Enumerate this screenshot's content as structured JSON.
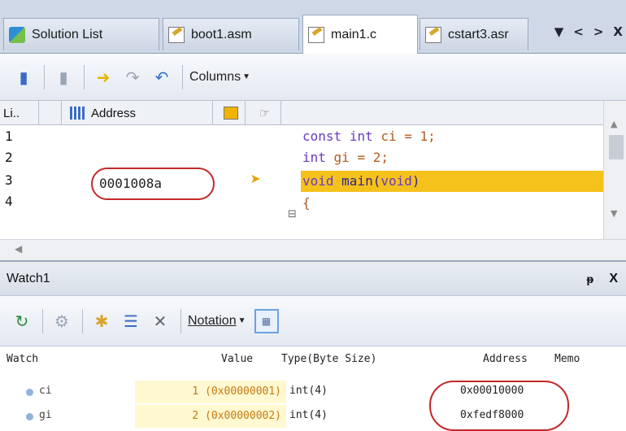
{
  "tabs": [
    {
      "label": "Solution List",
      "icon": "solution-icon"
    },
    {
      "label": "boot1.asm",
      "icon": "asm-file-icon"
    },
    {
      "label": "main1.c",
      "icon": "c-file-icon",
      "active": true
    },
    {
      "label": "cstart3.asr",
      "icon": "asm-file-icon"
    }
  ],
  "tab_controls": {
    "dropdown": "▼",
    "prev": "<",
    "next": ">",
    "close": "X"
  },
  "toolbar": {
    "columns_label": "Columns"
  },
  "editor": {
    "header": {
      "line_col": "Li..",
      "address_col": "Address"
    },
    "lines": [
      {
        "num": "1",
        "address": "",
        "code": "const int ci = 1;"
      },
      {
        "num": "2",
        "address": "",
        "code": "int gi = 2;"
      },
      {
        "num": "3",
        "address": "0001008a",
        "code": "void main(void)",
        "current": true
      },
      {
        "num": "4",
        "address": "",
        "code": "{"
      }
    ]
  },
  "watch": {
    "title": "Watch1",
    "pin": "ᵽ",
    "close": "X",
    "notation_label": "Notation",
    "columns": {
      "watch": "Watch",
      "value": "Value",
      "type": "Type(Byte Size)",
      "address": "Address",
      "memo": "Memo"
    },
    "rows": [
      {
        "name": "ci",
        "value": "1 (0x00000001)",
        "type": "int(4)",
        "address": "0x00010000"
      },
      {
        "name": "gi",
        "value": "2 (0x00000002)",
        "type": "int(4)",
        "address": "0xfedf8000"
      }
    ]
  },
  "colors": {
    "highlight": "#f5c21b",
    "annotation_circle": "#c42828",
    "value_bg": "#fff8d0"
  }
}
